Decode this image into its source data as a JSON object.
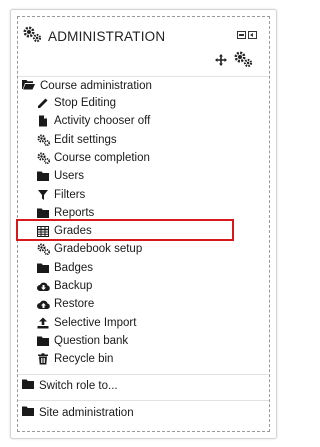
{
  "header": {
    "title": "ADMINISTRATION",
    "icon": "gears-icon"
  },
  "course_admin": {
    "label": "Course administration",
    "items": [
      {
        "label": "Stop Editing",
        "icon": "pencil-icon"
      },
      {
        "label": "Activity chooser off",
        "icon": "file-icon"
      },
      {
        "label": "Edit settings",
        "icon": "cog-icon"
      },
      {
        "label": "Course completion",
        "icon": "cog-icon"
      },
      {
        "label": "Users",
        "icon": "folder-icon"
      },
      {
        "label": "Filters",
        "icon": "filter-icon"
      },
      {
        "label": "Reports",
        "icon": "folder-icon"
      },
      {
        "label": "Grades",
        "icon": "table-icon"
      },
      {
        "label": "Gradebook setup",
        "icon": "cog-icon"
      },
      {
        "label": "Badges",
        "icon": "folder-icon"
      },
      {
        "label": "Backup",
        "icon": "cloud-download-icon"
      },
      {
        "label": "Restore",
        "icon": "cloud-upload-icon"
      },
      {
        "label": "Selective Import",
        "icon": "upload-icon"
      },
      {
        "label": "Question bank",
        "icon": "folder-icon"
      },
      {
        "label": "Recycle bin",
        "icon": "trash-icon"
      }
    ]
  },
  "switch_role": {
    "label": "Switch role to..."
  },
  "site_admin": {
    "label": "Site administration"
  },
  "colors": {
    "highlight": "#d7191c",
    "icon": "#1a1a1a",
    "border": "#d5d5d5"
  }
}
